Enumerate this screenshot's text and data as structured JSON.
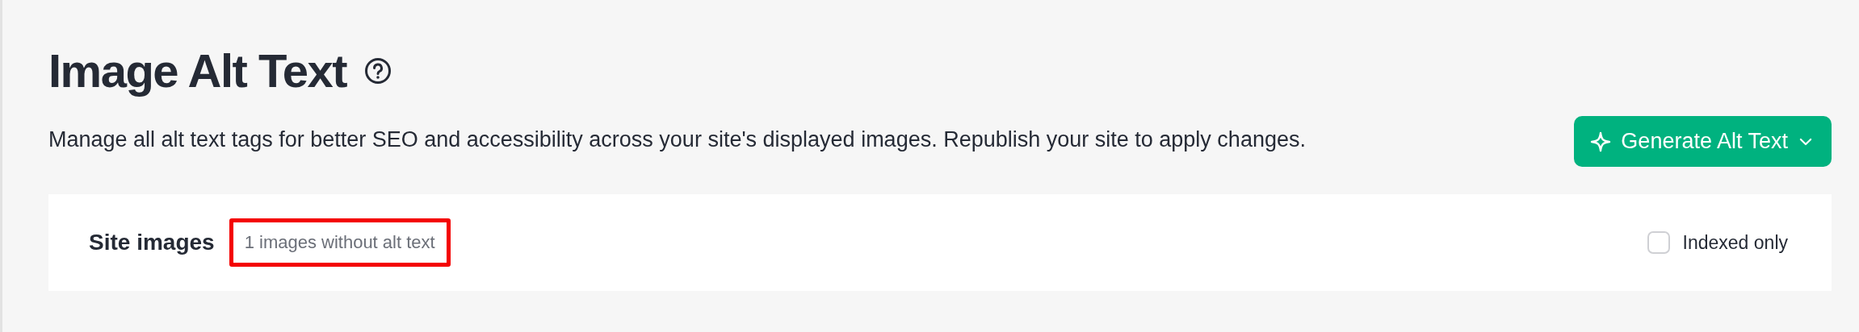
{
  "header": {
    "title": "Image Alt Text",
    "description": "Manage all alt text tags for better SEO and accessibility across your site's displayed images. Republish your site to apply changes."
  },
  "generate_button": {
    "label": "Generate Alt Text"
  },
  "site_images": {
    "title": "Site images",
    "count": "1 images without alt text",
    "highlighted": true,
    "indexed_only": {
      "label": "Indexed only",
      "checked": false
    }
  }
}
